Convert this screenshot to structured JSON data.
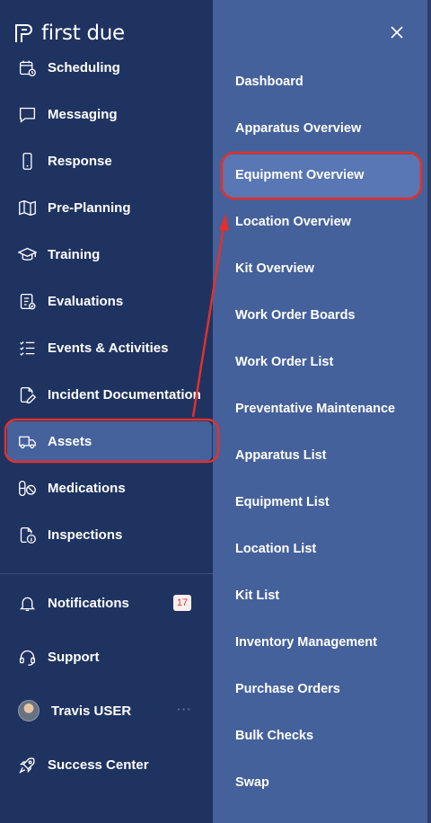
{
  "brand": {
    "name": "first due"
  },
  "nav": {
    "items": [
      {
        "label": "Scheduling"
      },
      {
        "label": "Messaging"
      },
      {
        "label": "Response"
      },
      {
        "label": "Pre-Planning"
      },
      {
        "label": "Training"
      },
      {
        "label": "Evaluations"
      },
      {
        "label": "Events & Activities"
      },
      {
        "label": "Incident Documentation"
      },
      {
        "label": "Assets",
        "active": true
      },
      {
        "label": "Medications"
      },
      {
        "label": "Inspections"
      }
    ],
    "bottom": [
      {
        "label": "Notifications",
        "badge": "17"
      },
      {
        "label": "Support"
      },
      {
        "label": "Travis USER",
        "more": "···"
      },
      {
        "label": "Success Center"
      }
    ]
  },
  "submenu": {
    "items": [
      {
        "label": "Dashboard"
      },
      {
        "label": "Apparatus Overview"
      },
      {
        "label": "Equipment Overview",
        "highlighted": true
      },
      {
        "label": "Location Overview"
      },
      {
        "label": "Kit Overview"
      },
      {
        "label": "Work Order Boards"
      },
      {
        "label": "Work Order List"
      },
      {
        "label": "Preventative Maintenance"
      },
      {
        "label": "Apparatus List"
      },
      {
        "label": "Equipment List"
      },
      {
        "label": "Location List"
      },
      {
        "label": "Kit List"
      },
      {
        "label": "Inventory Management"
      },
      {
        "label": "Purchase Orders"
      },
      {
        "label": "Bulk Checks"
      },
      {
        "label": "Swap"
      }
    ]
  },
  "colors": {
    "sidebar_bg": "#1f3361",
    "submenu_bg": "#45619b",
    "active_bg": "#46629c",
    "annotation_red": "#e3302b",
    "badge_text": "#d23a3a"
  }
}
